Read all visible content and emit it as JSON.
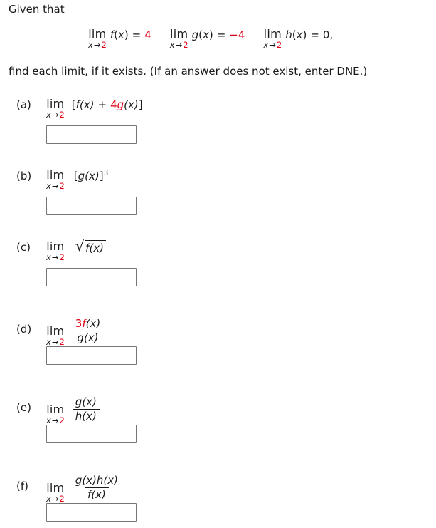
{
  "prompt": {
    "given_label": "Given that",
    "instruction": "find each limit, if it exists. (If an answer does not exist, enter DNE.)"
  },
  "colors": {
    "red": "#e00014",
    "text": "#1a1a1a",
    "box_border": "#767676",
    "background": "#ffffff"
  },
  "lim_word": "lim",
  "lim_sub": {
    "var": "x",
    "arrow": "→",
    "value": "2"
  },
  "given": [
    {
      "id": "given-f",
      "func": "f",
      "open": "(",
      "arg": "x",
      "close": ")",
      "equals": "=",
      "value": "4",
      "value_color": "red",
      "trailing": ""
    },
    {
      "id": "given-g",
      "func": "g",
      "open": "(",
      "arg": "x",
      "close": ")",
      "equals": "=",
      "value": "−4",
      "value_color": "red",
      "trailing": ""
    },
    {
      "id": "given-h",
      "func": "h",
      "open": "(",
      "arg": "x",
      "close": ")",
      "equals": "=",
      "value": "0",
      "value_color": "black",
      "trailing": ","
    }
  ],
  "questions": [
    {
      "id": "a",
      "label": "(a)",
      "kind": "inline",
      "expression_text": "[f(x) + 4g(x)]",
      "parts": {
        "bracket_open": "[",
        "f": "f",
        "f_arg": "(x)",
        "plus": "+",
        "coef": "4",
        "g": "g",
        "g_arg": "(x)",
        "bracket_close": "]"
      },
      "answer_value": "",
      "answer_placeholder": ""
    },
    {
      "id": "b",
      "label": "(b)",
      "kind": "power",
      "expression_text": "[g(x)]^3",
      "parts": {
        "bracket_open": "[",
        "g": "g",
        "g_arg": "(x)",
        "bracket_close": "]",
        "exponent": "3"
      },
      "answer_value": "",
      "answer_placeholder": ""
    },
    {
      "id": "c",
      "label": "(c)",
      "kind": "sqrt",
      "expression_text": "√(f(x))",
      "parts": {
        "radical": "√",
        "f": "f",
        "f_arg": "(x)"
      },
      "answer_value": "",
      "answer_placeholder": ""
    },
    {
      "id": "d",
      "label": "(d)",
      "kind": "fraction",
      "expression_text": "3f(x) / g(x)",
      "parts": {
        "num_coef": "3",
        "num_func": "f",
        "num_arg": "(x)",
        "den_func": "g",
        "den_arg": "(x)"
      },
      "answer_value": "",
      "answer_placeholder": ""
    },
    {
      "id": "e",
      "label": "(e)",
      "kind": "fraction",
      "expression_text": "g(x) / h(x)",
      "parts": {
        "num_func": "g",
        "num_arg": "(x)",
        "den_func": "h",
        "den_arg": "(x)"
      },
      "answer_value": "",
      "answer_placeholder": ""
    },
    {
      "id": "f",
      "label": "(f)",
      "kind": "fraction",
      "expression_text": "g(x)h(x) / f(x)",
      "parts": {
        "num_func": "g",
        "num_arg": "(x)",
        "num_func2": "h",
        "num_arg2": "(x)",
        "den_func": "f",
        "den_arg": "(x)"
      },
      "answer_value": "",
      "answer_placeholder": ""
    }
  ]
}
